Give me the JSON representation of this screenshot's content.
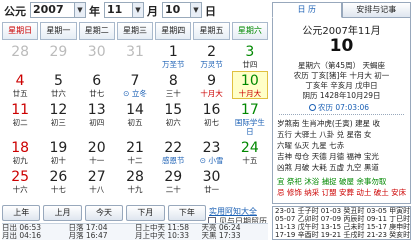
{
  "header": {
    "era": "公元",
    "year": "2007",
    "year_unit": "年",
    "month": "11",
    "month_unit": "月",
    "day": "10",
    "day_unit": "日"
  },
  "weekdays": [
    "星期日",
    "星期一",
    "星期二",
    "星期三",
    "星期四",
    "星期五",
    "星期六"
  ],
  "calendar": [
    [
      {
        "d": "28",
        "l": ""
      },
      {
        "d": "29",
        "l": ""
      },
      {
        "d": "30",
        "l": ""
      },
      {
        "d": "31",
        "l": ""
      },
      {
        "d": "1",
        "l": "万圣节"
      },
      {
        "d": "2",
        "l": "万灵节"
      },
      {
        "d": "3",
        "l": "廿四"
      }
    ],
    [
      {
        "d": "4",
        "l": "廿五"
      },
      {
        "d": "5",
        "l": "廿六"
      },
      {
        "d": "6",
        "l": "廿七"
      },
      {
        "d": "7",
        "l": "⊙ 立冬"
      },
      {
        "d": "8",
        "l": "三十"
      },
      {
        "d": "9",
        "l": "十月大"
      },
      {
        "d": "10",
        "l": "十月大"
      }
    ],
    [
      {
        "d": "11",
        "l": "初二"
      },
      {
        "d": "12",
        "l": "初三"
      },
      {
        "d": "13",
        "l": "初四"
      },
      {
        "d": "14",
        "l": "初五"
      },
      {
        "d": "15",
        "l": "初六"
      },
      {
        "d": "16",
        "l": "初七"
      },
      {
        "d": "17",
        "l": "国际学生日"
      }
    ],
    [
      {
        "d": "18",
        "l": "初九"
      },
      {
        "d": "19",
        "l": "初十"
      },
      {
        "d": "20",
        "l": "十一"
      },
      {
        "d": "21",
        "l": "十二"
      },
      {
        "d": "22",
        "l": "感恩节"
      },
      {
        "d": "23",
        "l": "⊙ 小雪"
      },
      {
        "d": "24",
        "l": "十五"
      }
    ],
    [
      {
        "d": "25",
        "l": "十六"
      },
      {
        "d": "26",
        "l": "十七"
      },
      {
        "d": "27",
        "l": "十八"
      },
      {
        "d": "28",
        "l": "十九"
      },
      {
        "d": "29",
        "l": "二十"
      },
      {
        "d": "30",
        "l": "廿一"
      },
      {
        "d": "",
        "l": ""
      }
    ],
    [
      {
        "d": "",
        "l": ""
      },
      {
        "d": "",
        "l": ""
      },
      {
        "d": "",
        "l": ""
      },
      {
        "d": "",
        "l": ""
      },
      {
        "d": "",
        "l": ""
      },
      {
        "d": "",
        "l": ""
      },
      {
        "d": "",
        "l": ""
      }
    ]
  ],
  "links": {
    "almanac": "实用阿知大全",
    "checkbox": "见与日期贸历"
  },
  "nav": [
    "上年",
    "上月",
    "今天",
    "下月",
    "下年"
  ],
  "times": [
    "日出 06:53",
    "日落 17:04",
    "日上中天 11:58",
    "天亮 06:24",
    "月出 04:16",
    "月落 16:47",
    "月上中天 10:33",
    "天黑 17:33"
  ],
  "tabs": [
    "日 历",
    "安排与记事"
  ],
  "detail": {
    "title": "公元2007年11月",
    "big_day": "10",
    "line1": "星期六（第45周） 天蝎座",
    "line2": "农历 丁亥[猪]年 十月大 初一",
    "line3": "丁亥年 辛亥月 戊申日",
    "line4": "阴历 1428年10月29日",
    "line5": "农历 07:03:06",
    "line6": "岁煞南 生肖冲虎(壬寅) 建星 收",
    "line7": "五行 大驿土 八卦 兑 星宿 女",
    "line8": "六曜 仏灭 九星 七赤",
    "line9": "吉神 母仓 天德 月德 福神 宝光",
    "line10": "凶煞 月破 大耗 五虚 九空 黑道",
    "line11": "宜 祭祀 沐浴 捕捉 破屋 余事勿取",
    "line12": "忌 修饰 纳采 订盟 安葬 动土 破土 安床"
  },
  "hours": [
    "23-01 壬子时  01-03 癸丑时  03-05 甲寅时",
    "05-07 乙卯时  07-09 丙辰时  09-11 丁巳时",
    "11-13 戊午时  13-15 己未时  15-17 庚申时",
    "17-19 辛酉时  19-21 壬戌时  21-23 癸亥时"
  ],
  "colors": {
    "sunday": "#c00000",
    "saturday": "#008000",
    "festival": "#1a5fb4",
    "today_bg": "#ffffc8"
  }
}
